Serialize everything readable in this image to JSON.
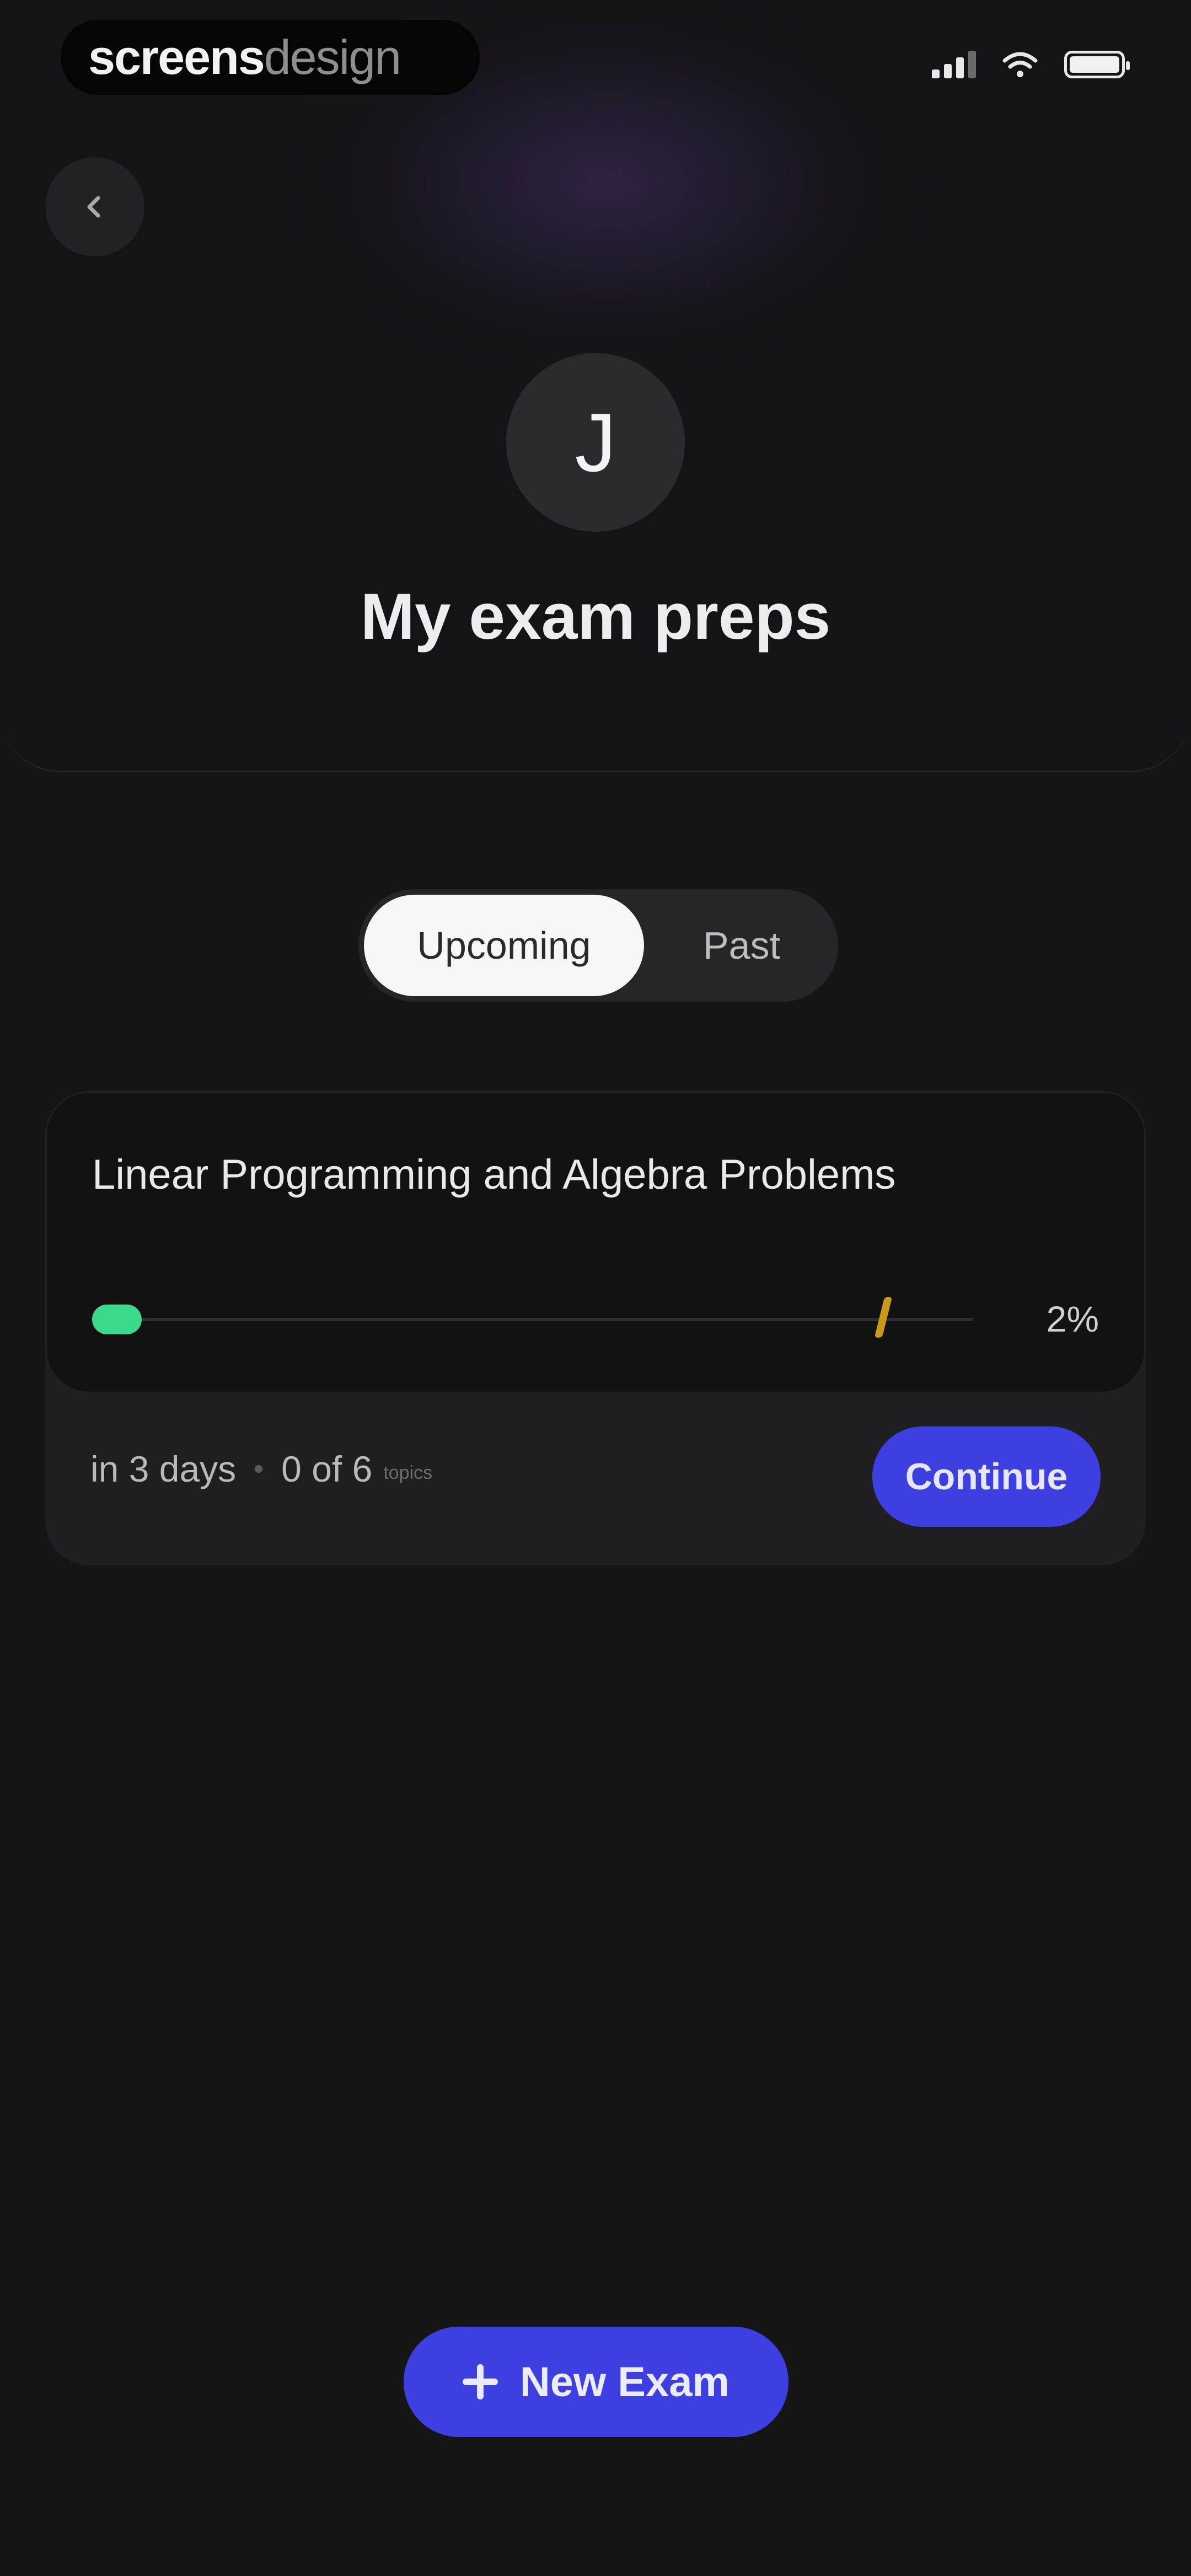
{
  "status_bar": {
    "brand_part1": "screens",
    "brand_part2": "design"
  },
  "header": {
    "avatar_initial": "J",
    "title": "My exam preps"
  },
  "tabs": {
    "items": [
      {
        "label": "Upcoming",
        "selected": true
      },
      {
        "label": "Past",
        "selected": false
      }
    ]
  },
  "exam_card": {
    "title": "Linear Programming and Algebra Problems",
    "progress_percent_text": "2%",
    "progress_fraction": 0.02,
    "due": "in 3 days",
    "topics_count": "0 of 6",
    "topics_label": "topics",
    "continue_label": "Continue"
  },
  "new_exam": {
    "label": "New Exam"
  },
  "colors": {
    "accent": "#3d3fe0",
    "progress": "#3ad98c",
    "goal_marker": "#c99a1a",
    "background": "#151516"
  },
  "icons": [
    "back-chevron-icon",
    "signal-icon",
    "wifi-icon",
    "battery-icon",
    "plus-icon"
  ]
}
